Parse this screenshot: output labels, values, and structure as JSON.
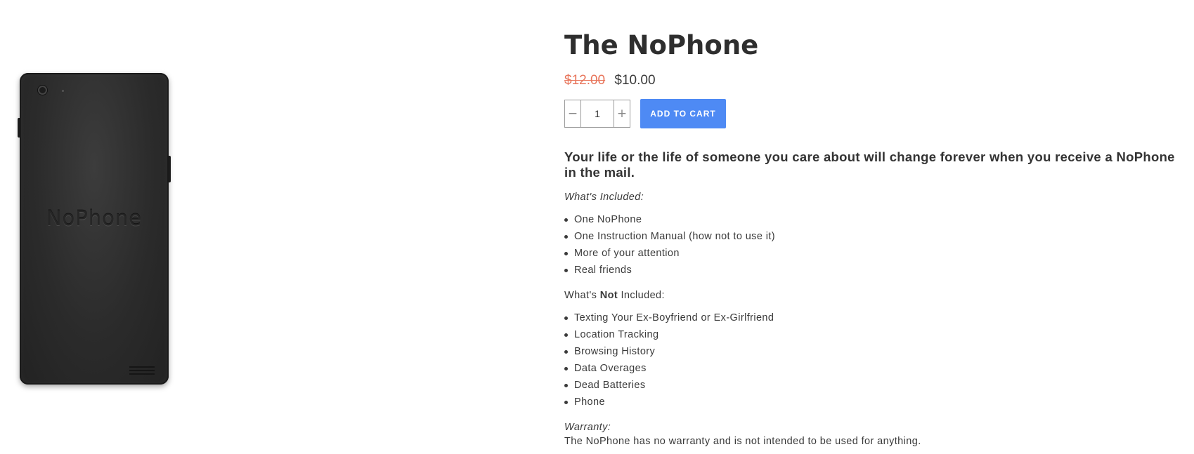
{
  "product": {
    "title": "The NoPhone",
    "image_brand_text": "NoPhone",
    "compare_price": "$12.00",
    "price": "$10.00",
    "quantity": "1",
    "qty_minus": "−",
    "qty_plus": "+",
    "add_to_cart_label": "ADD TO CART"
  },
  "description": {
    "lead": "Your life or the life of someone you care about will change forever when you receive a NoPhone in the mail.",
    "included_heading": "What's Included:",
    "included_items": [
      "One NoPhone",
      "One Instruction Manual (how not to use it)",
      "More of your attention",
      "Real friends"
    ],
    "not_included_prefix": "What's ",
    "not_included_emphasis": "Not",
    "not_included_suffix": " Included:",
    "not_included_items": [
      "Texting Your Ex-Boyfriend or Ex-Girlfriend",
      "Location Tracking",
      "Browsing History",
      "Data Overages",
      "Dead Batteries",
      "Phone"
    ],
    "warranty_heading": "Warranty:",
    "warranty_text": "The NoPhone has no warranty and is not intended to be used for anything."
  },
  "colors": {
    "button": "#4e8af4",
    "compare_price": "#e8765c"
  }
}
